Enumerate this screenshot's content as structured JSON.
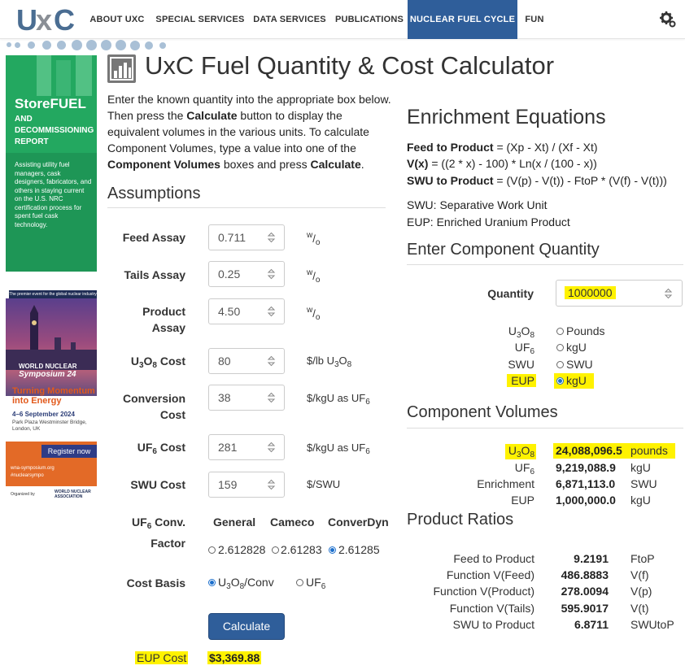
{
  "nav": {
    "items": [
      "ABOUT UXC",
      "SPECIAL SERVICES",
      "DATA SERVICES",
      "PUBLICATIONS",
      "NUCLEAR FUEL CYCLE",
      "FUN"
    ],
    "active_index": 4,
    "active_color": "#2f5e9a"
  },
  "logo": {
    "u": "U",
    "x": "x",
    "c": "C"
  },
  "ads": {
    "storefuel": {
      "title": "StoreFUEL",
      "subtitle": "AND DECOMMISSIONING REPORT",
      "body": "Assisting utility fuel managers, cask designers, fabricators, and others in staying current on the U.S. NRC certification process for spent fuel cask technology."
    },
    "wns": {
      "tagline": "The premier event for the global nuclear industry",
      "logo_line1": "WORLD NUCLEAR",
      "logo_line2": "Symposium 24",
      "headline": "Turning Momentum into Energy",
      "dates": "4–6 September 2024",
      "venue": "Park Plaza Westminster Bridge, London, UK",
      "register": "Register now",
      "web1": "wna-symposium.org",
      "web2": "#nuclearsympo",
      "organised_by": "Organized by",
      "org_name1": "WORLD NUCLEAR",
      "org_name2": "ASSOCIATION"
    }
  },
  "page": {
    "title": "UxC Fuel Quantity & Cost Calculator",
    "intro_1": "Enter the known quantity into the appropriate box below. Then press the ",
    "intro_calc": "Calculate",
    "intro_2": " button to display the equivalent volumes in the various units. To calculate Component Volumes, type a value into one of the ",
    "intro_cv": "Component Volumes",
    "intro_3": " boxes and press ",
    "intro_calc2": "Calculate",
    "intro_4": "."
  },
  "assumptions": {
    "title": "Assumptions",
    "feed_assay_label": "Feed Assay",
    "feed_assay_value": "0.711",
    "tails_assay_label": "Tails Assay",
    "tails_assay_value": "0.25",
    "product_assay_label_1": "Product",
    "product_assay_label_2": "Assay",
    "product_assay_value": "4.50",
    "assay_unit_w": "w",
    "assay_unit_o": "o",
    "u3o8_cost_label": "Cost",
    "u3o8_cost_value": "80",
    "u3o8_cost_unit": "$/lb U",
    "conversion_cost_label_1": "Conversion",
    "conversion_cost_label_2": "Cost",
    "conversion_cost_value": "38",
    "conversion_cost_unit": "$/kgU as UF",
    "uf6_cost_label": "Cost",
    "uf6_cost_value": "281",
    "uf6_cost_unit": "$/kgU as UF",
    "swu_cost_label": "SWU Cost",
    "swu_cost_value": "159",
    "swu_cost_unit": "$/SWU",
    "conv_factor_label_1": "Conv.",
    "conv_factor_label_2": "Factor",
    "conv_factor_headers": [
      "General",
      "Cameco",
      "ConverDyn"
    ],
    "conv_factor_options": [
      "2.612828",
      "2.61283",
      "2.61285"
    ],
    "conv_factor_selected": 2,
    "cost_basis_label": "Cost Basis",
    "cost_basis_options": [
      "U3O8/Conv",
      "UF6"
    ],
    "cost_basis_selected": 0,
    "calculate_label": "Calculate",
    "eup_cost_label": "EUP Cost",
    "eup_cost_value": "$3,369.88"
  },
  "equations": {
    "title": "Enrichment Equations",
    "f2p_label": "Feed to Product",
    "f2p_expr": " = (Xp - Xt) / (Xf - Xt)",
    "vx_label": "V(x)",
    "vx_expr": " = ((2 * x) - 100) * Ln(x / (100 - x))",
    "swu_label": "SWU to Product",
    "swu_expr": " = (V(p) - V(t)) - FtoP * (V(f) - V(t)))",
    "swu_def": "SWU: Separative Work Unit",
    "eup_def": "EUP: Enriched Uranium Product"
  },
  "component_quantity": {
    "title": "Enter Component Quantity",
    "quantity_label": "Quantity",
    "quantity_value": "1000000",
    "options": [
      {
        "label": "U3O8",
        "unit": "Pounds"
      },
      {
        "label": "UF6",
        "unit": "kgU"
      },
      {
        "label": "SWU",
        "unit": "SWU"
      },
      {
        "label": "EUP",
        "unit": "kgU"
      }
    ],
    "selected": 3
  },
  "component_volumes": {
    "title": "Component Volumes",
    "rows": [
      {
        "label": "U3O8",
        "value": "24,088,096.5",
        "unit": "pounds"
      },
      {
        "label": "UF6",
        "value": "9,219,088.9",
        "unit": "kgU"
      },
      {
        "label": "Enrichment",
        "value": "6,871,113.0",
        "unit": "SWU"
      },
      {
        "label": "EUP",
        "value": "1,000,000.0",
        "unit": "kgU"
      }
    ]
  },
  "product_ratios": {
    "title": "Product Ratios",
    "rows": [
      {
        "label": "Feed to Product",
        "value": "9.2191",
        "unit": "FtoP"
      },
      {
        "label": "Function V(Feed)",
        "value": "486.8883",
        "unit": "V(f)"
      },
      {
        "label": "Function V(Product)",
        "value": "278.0094",
        "unit": "V(p)"
      },
      {
        "label": "Function V(Tails)",
        "value": "595.9017",
        "unit": "V(t)"
      },
      {
        "label": "SWU to Product",
        "value": "6.8711",
        "unit": "SWUtoP"
      }
    ]
  },
  "colors": {
    "highlight": "#fff200",
    "primary_button": "#2f5e9a",
    "storefuel_green": "#23a860",
    "wns_orange": "#e36a27"
  },
  "chem": {
    "U": "U",
    "O": "O",
    "F": "F",
    "s3": "3",
    "s8": "8",
    "s6": "6"
  }
}
